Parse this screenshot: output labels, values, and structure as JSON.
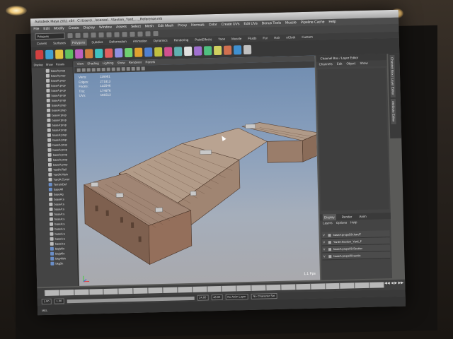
{
  "window": {
    "title": "Autodesk Maya 2011 x64 : C:\\Users\\...\\scenes\\...\\Section_Yard_..._Reference.mb"
  },
  "menubar": [
    "File",
    "Edit",
    "Modify",
    "Create",
    "Display",
    "Window",
    "Assets",
    "Select",
    "Mesh",
    "Edit Mesh",
    "Proxy",
    "Normals",
    "Color",
    "Create UVs",
    "Edit UVs",
    "Bonus Tools",
    "Muscle",
    "Pipeline Cache",
    "Help"
  ],
  "toolbar": {
    "mode": "Polygons"
  },
  "shelf_tabs": [
    {
      "label": "Curves",
      "active": false
    },
    {
      "label": "Surfaces",
      "active": false
    },
    {
      "label": "Polygons",
      "active": true
    },
    {
      "label": "Subdivs",
      "active": false
    },
    {
      "label": "Deformation",
      "active": false
    },
    {
      "label": "Animation",
      "active": false
    },
    {
      "label": "Dynamics",
      "active": false
    },
    {
      "label": "Rendering",
      "active": false
    },
    {
      "label": "PaintEffects",
      "active": false
    },
    {
      "label": "Toon",
      "active": false
    },
    {
      "label": "Muscle",
      "active": false
    },
    {
      "label": "Fluids",
      "active": false
    },
    {
      "label": "Fur",
      "active": false
    },
    {
      "label": "Hair",
      "active": false
    },
    {
      "label": "nCloth",
      "active": false
    },
    {
      "label": "Custom",
      "active": false
    }
  ],
  "shelf_icon_colors": [
    "#d04040",
    "#40a0d0",
    "#e0c040",
    "#60c060",
    "#c060c0",
    "#d08040",
    "#40c0c0",
    "#e06060",
    "#9090e0",
    "#70d070",
    "#e0a030",
    "#5080d0",
    "#c0c040",
    "#d05090",
    "#60b0b0",
    "#e0e0e0",
    "#a070d0",
    "#50c080",
    "#d0d060",
    "#d07050",
    "#4090d0",
    "#c0c0c0"
  ],
  "outliner": {
    "menu": [
      "Display",
      "Show",
      "Panels"
    ],
    "items": [
      {
        "label": "baseA:prop",
        "icon": "mesh"
      },
      {
        "label": "baseA:prop",
        "icon": "mesh"
      },
      {
        "label": "baseA:prop",
        "icon": "mesh"
      },
      {
        "label": "baseA:prop",
        "icon": "mesh"
      },
      {
        "label": "baseA:prop",
        "icon": "mesh"
      },
      {
        "label": "baseA:prop",
        "icon": "mesh"
      },
      {
        "label": "baseA:prop",
        "icon": "mesh"
      },
      {
        "label": "baseA:prop",
        "icon": "mesh"
      },
      {
        "label": "baseA:prop",
        "icon": "mesh"
      },
      {
        "label": "baseA:prop",
        "icon": "mesh"
      },
      {
        "label": "baseA:prop",
        "icon": "mesh"
      },
      {
        "label": "baseA:prop",
        "icon": "mesh"
      },
      {
        "label": "baseA:prop",
        "icon": "mesh"
      },
      {
        "label": "baseA:prop",
        "icon": "mesh"
      },
      {
        "label": "baseA:prop",
        "icon": "mesh"
      },
      {
        "label": "baseA:prop",
        "icon": "mesh"
      },
      {
        "label": "baseA:prop",
        "icon": "mesh"
      },
      {
        "label": "baseA:prop",
        "icon": "mesh"
      },
      {
        "label": "baseA:prop",
        "icon": "mesh"
      },
      {
        "label": "baseA:prop",
        "icon": "mesh"
      },
      {
        "label": "YardA:Rail",
        "icon": "mesh"
      },
      {
        "label": "YardA:Main",
        "icon": "mesh"
      },
      {
        "label": "YardA:Const",
        "icon": "mesh"
      },
      {
        "label": "TerrainDef",
        "icon": "node"
      },
      {
        "label": "baseAll",
        "icon": "node"
      },
      {
        "label": "baseAg",
        "icon": "mesh"
      },
      {
        "label": "baseA:s",
        "icon": "mesh"
      },
      {
        "label": "baseA:s",
        "icon": "mesh"
      },
      {
        "label": "baseA:s",
        "icon": "mesh"
      },
      {
        "label": "baseA:s",
        "icon": "mesh"
      },
      {
        "label": "baseA:s",
        "icon": "mesh"
      },
      {
        "label": "baseA:s",
        "icon": "mesh"
      },
      {
        "label": "baseA:s",
        "icon": "mesh"
      },
      {
        "label": "baseA:s",
        "icon": "mesh"
      },
      {
        "label": "baseA:s",
        "icon": "mesh"
      },
      {
        "label": "baseA:s",
        "icon": "mesh"
      },
      {
        "label": "bkgWin",
        "icon": "node"
      },
      {
        "label": "bkgWin",
        "icon": "node"
      },
      {
        "label": "bkg4Wn",
        "icon": "node"
      },
      {
        "label": "bkg3n",
        "icon": "node"
      }
    ]
  },
  "viewport": {
    "menu": [
      "View",
      "Shading",
      "Lighting",
      "Show",
      "Renderer",
      "Panels"
    ],
    "hud": [
      {
        "label": "Verts:",
        "value": "116981"
      },
      {
        "label": "Edges:",
        "value": "271813"
      },
      {
        "label": "Faces:",
        "value": "132546"
      },
      {
        "label": "Tris:",
        "value": "174976"
      },
      {
        "label": "UVs:",
        "value": "181513"
      }
    ],
    "fps": "1.1 Fps"
  },
  "channel_box": {
    "title": "Channel Box / Layer Editor",
    "menu": [
      "Channels",
      "Edit",
      "Object",
      "Show"
    ],
    "layer_tabs": [
      {
        "label": "Display",
        "active": true
      },
      {
        "label": "Render",
        "active": false
      },
      {
        "label": "Anim",
        "active": false
      }
    ],
    "layer_menu": [
      "Layers",
      "Options",
      "Help"
    ],
    "layers": [
      {
        "name": "baseA:props59t:hardT"
      },
      {
        "name": "YardA:Section_Yard_F"
      },
      {
        "name": "baseA:props09:Section"
      },
      {
        "name": "baseA:props09:sectio"
      }
    ]
  },
  "side_tabs": [
    "Channel Box / Layer Editor",
    "Attribute Editor"
  ],
  "timeline": {
    "start": "1.00",
    "end": "24.00"
  },
  "range": {
    "start": "1.00",
    "inner_start": "1.00",
    "inner_end": "24.00",
    "end": "48.00",
    "anim_layer": "No Anim Layer",
    "char_set": "No Character Set"
  },
  "statusbar": {
    "label": "MEL"
  }
}
